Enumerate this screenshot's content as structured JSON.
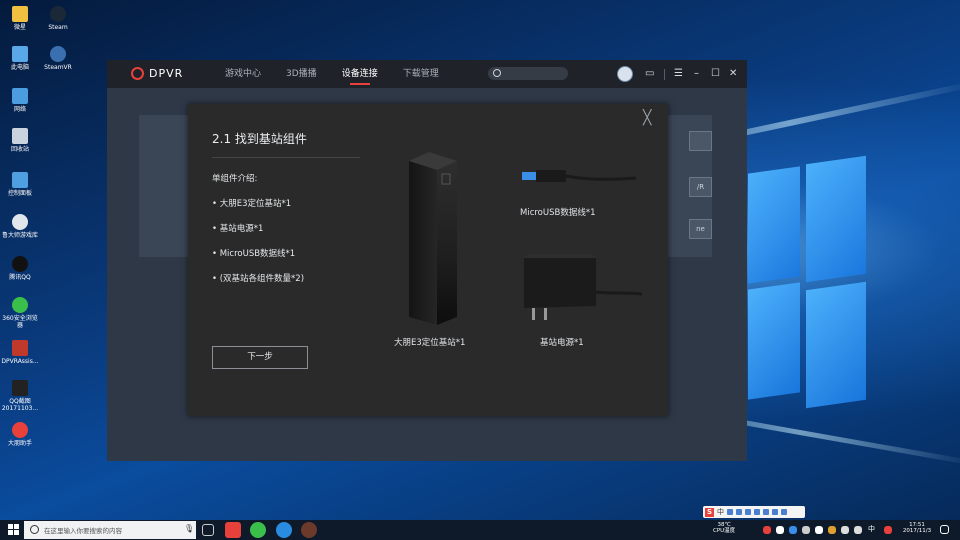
{
  "desktop": {
    "icons": [
      {
        "label": "微星"
      },
      {
        "label": "Steam"
      },
      {
        "label": "此电脑"
      },
      {
        "label": "SteamVR"
      },
      {
        "label": "网络"
      },
      {
        "label": "回收站"
      },
      {
        "label": "控制面板"
      },
      {
        "label": "鲁大师游戏库"
      },
      {
        "label": "腾讯QQ"
      },
      {
        "label": "360安全浏览器"
      },
      {
        "label": "DPVRAssis..."
      },
      {
        "label": "QQ截图20171103..."
      },
      {
        "label": "大朋助手"
      }
    ]
  },
  "app": {
    "brand": "DPVR",
    "nav": [
      "游戏中心",
      "3D播播",
      "设备连接",
      "下载管理"
    ],
    "active_nav": "设备连接",
    "window_buttons": {
      "menu": "☰",
      "minimize": "–",
      "maximize": "☐",
      "close": "✕"
    },
    "bg_buttons": [
      "",
      "/R",
      "ne"
    ]
  },
  "modal": {
    "title": "2.1 找到基站组件",
    "intro": "单组件介绍:",
    "items": [
      "• 大朋E3定位基站*1",
      "• 基站电源*1",
      "• MicroUSB数据线*1",
      "• (双基站各组件数量*2)"
    ],
    "next_button": "下一步",
    "close": "╳",
    "captions": {
      "tower": "大朋E3定位基站*1",
      "usb": "MicroUSB数据线*1",
      "power": "基站电源*1"
    },
    "tower_logo": "D"
  },
  "taskbar": {
    "search_placeholder": "在这里输入你要搜索的内容",
    "temperature": "38℃",
    "temp_label": "CPU温度",
    "time": "17:51",
    "date": "2017/11/3",
    "ime_label": "中",
    "tray_ime": "中"
  },
  "colors": {
    "accent": "#e8403a",
    "title_bar": "#1f2329",
    "modal_bg": "#2a2a2b",
    "app_bg": "#2e3846"
  }
}
